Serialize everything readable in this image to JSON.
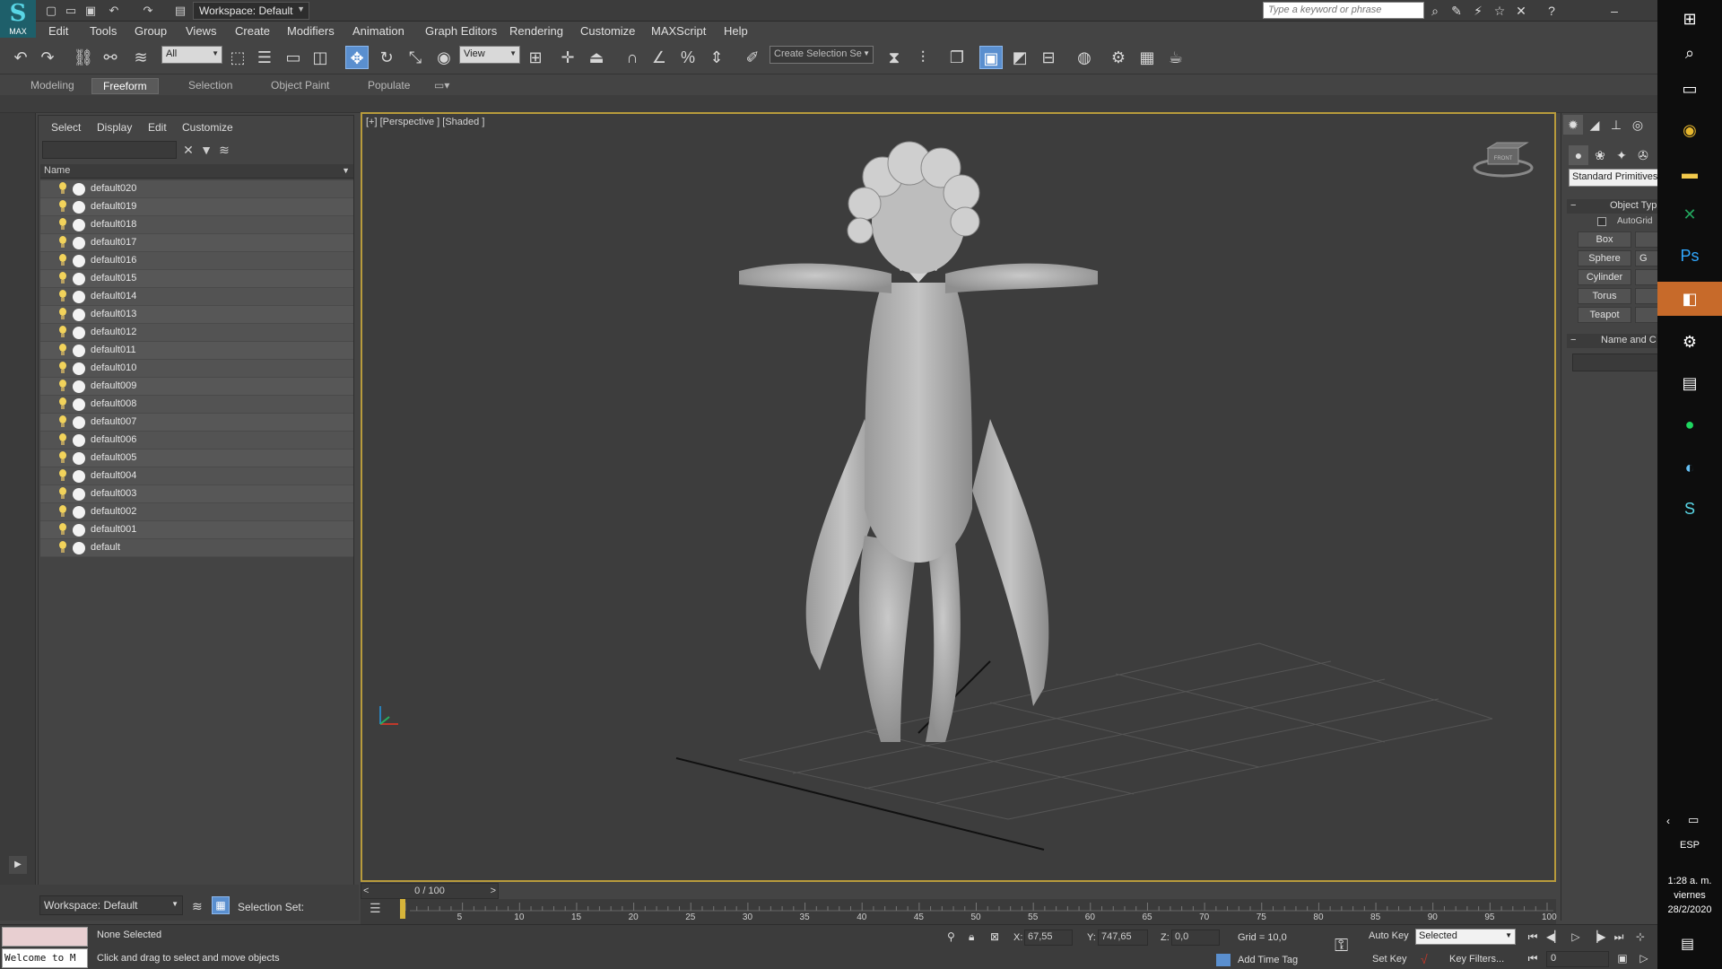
{
  "app": {
    "logo_text": "MAX",
    "workspace": "Workspace: Default",
    "search_placeholder": "Type a keyword or phrase"
  },
  "menu": [
    "Edit",
    "Tools",
    "Group",
    "Views",
    "Create",
    "Modifiers",
    "Animation",
    "Graph Editors",
    "Rendering",
    "Customize",
    "MAXScript",
    "Help"
  ],
  "toolbar": {
    "filter_value": "All",
    "ref_coord_value": "View",
    "selection_set_placeholder": "Create Selection Se"
  },
  "ribbon_tabs": [
    {
      "label": "Modeling",
      "active": false
    },
    {
      "label": "Freeform",
      "active": true
    },
    {
      "label": "Selection",
      "active": false
    },
    {
      "label": "Object Paint",
      "active": false
    },
    {
      "label": "Populate",
      "active": false
    }
  ],
  "scene_explorer": {
    "menu": [
      "Select",
      "Display",
      "Edit",
      "Customize"
    ],
    "column_header": "Name",
    "objects": [
      "default020",
      "default019",
      "default018",
      "default017",
      "default016",
      "default015",
      "default014",
      "default013",
      "default012",
      "default011",
      "default010",
      "default009",
      "default008",
      "default007",
      "default006",
      "default005",
      "default004",
      "default003",
      "default002",
      "default001",
      "default"
    ]
  },
  "left_bottom": {
    "workspace": "Workspace: Default",
    "selection_set_label": "Selection Set:"
  },
  "viewport": {
    "label": "[+] [Perspective ] [Shaded ]",
    "viewcube_face": "FRONT"
  },
  "timeline": {
    "current": "0 / 100",
    "ticks": [
      "5",
      "10",
      "15",
      "20",
      "25",
      "30",
      "35",
      "40",
      "45",
      "50",
      "55",
      "60",
      "65",
      "70",
      "75",
      "80",
      "85",
      "90",
      "95",
      "100"
    ]
  },
  "command_panel": {
    "primitive_type": "Standard Primitives",
    "object_type_label": "Object Typ",
    "autogrid_label": "AutoGrid",
    "buttons": [
      "Box",
      "Sphere",
      "Cylinder",
      "Torus",
      "Teapot"
    ],
    "button_second_col": [
      "",
      "G",
      "",
      "",
      ""
    ],
    "name_color_label": "Name and C"
  },
  "status": {
    "maxscript_output": "Welcome to M",
    "selection_info": "None Selected",
    "prompt": "Click and drag to select and move objects",
    "x_label": "X:",
    "x_value": "67,55",
    "y_label": "Y:",
    "y_value": "747,65",
    "z_label": "Z:",
    "z_value": "0,0",
    "grid": "Grid = 10,0",
    "add_time_tag": "Add Time Tag",
    "auto_key": "Auto Key",
    "set_key": "Set Key",
    "selected_dd": "Selected",
    "key_filters": "Key Filters...",
    "frame": "0"
  },
  "taskbar": {
    "language": "ESP",
    "time": "1:28 a. m.",
    "day": "viernes",
    "date": "28/2/2020"
  },
  "colors": {
    "viewport_border": "#b89b3c",
    "active_tool": "#5a8fcf",
    "taskbar_highlight": "#c76a2a"
  }
}
